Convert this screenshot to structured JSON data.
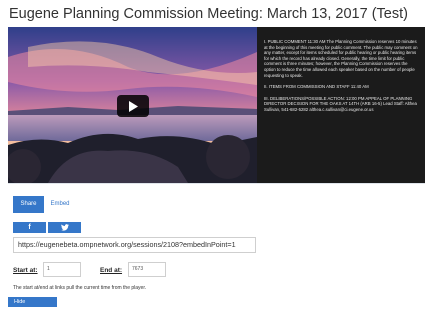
{
  "page": {
    "title": "Eugene Planning Commission Meeting: March 13, 2017 (Test)"
  },
  "player": {
    "play_icon": "play-icon",
    "agenda": [
      "I. PUBLIC COMMENT 11:30 AM The Planning Commission reserves 10 minutes at the beginning of this meeting for public comment. The public may comment on any matter, except for items scheduled for public hearing or public hearing items for which the record has already closed. Generally, the time limit for public comment is three minutes; however, the Planning Commission reserves the option to reduce the time allowed each speaker based on the number of people requesting to speak.",
      "II. ITEMS FROM COMMISSION AND STAFF 11:40 AM",
      "III. DELIBERATIONS/POSSIBLE ACTION: 12:00 PM APPEAL OF PLANNING DIRECTOR DECISION FOR THE OAKS AT 14TH (ARB 16-5) Lead Staff: Althea Sullivan, 541-682-5282 althea.c.sullivan@ci.eugene.or.us"
    ]
  },
  "share": {
    "tabs": [
      "Share",
      "Embed"
    ],
    "facebook_label": "f",
    "twitter_icon": "twitter-bird-icon",
    "url": "https://eugenebeta.ompnetwork.org/sessions/2108?embedInPoint=1",
    "start_label": "Start at:",
    "start_value": "1",
    "end_label": "End at:",
    "end_value": "7673",
    "note": "The start at/end at links pull the current time from the player.",
    "hide_label": "Hide"
  },
  "colors": {
    "accent": "#3577c9",
    "agenda_bg": "#1b1b1b"
  }
}
